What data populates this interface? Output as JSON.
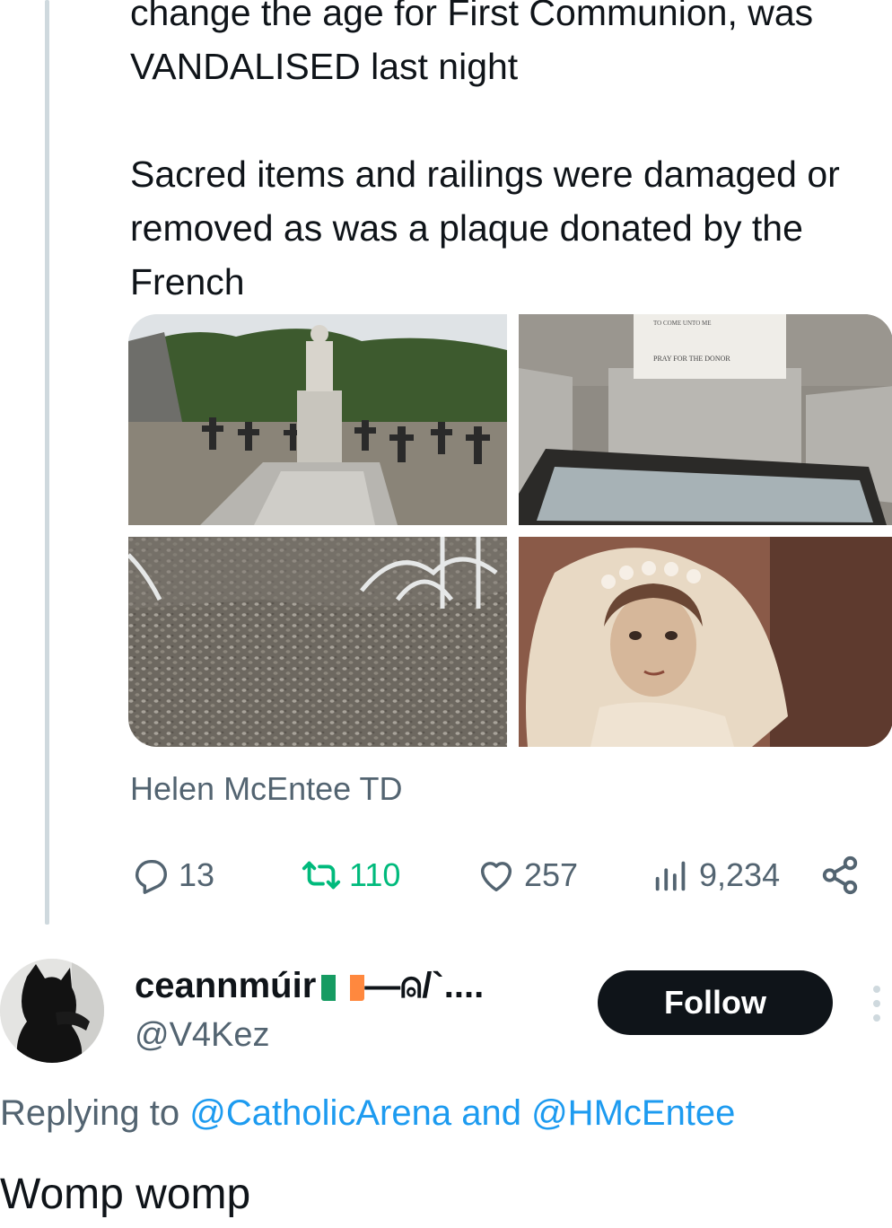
{
  "tweet": {
    "text_line1": "change the age for First Communion, was",
    "text_line2": "VANDALISED last night",
    "text_para2": "Sacred items and railings were damaged or removed as was a plaque donated by the French",
    "source_label": "Helen McEntee TD",
    "stats": {
      "replies": "13",
      "retweets": "110",
      "likes": "257",
      "views": "9,234"
    },
    "plaque_text_1": "TO COME UNTO ME",
    "plaque_text_2": "PRAY FOR THE DONOR"
  },
  "reply": {
    "display_name": "ceannmúir",
    "name_suffix": "—⍝/`....",
    "handle": "@V4Kez",
    "follow_label": "Follow",
    "replying_prefix": "Replying to",
    "replying_mentions": "@CatholicArena and @HMcEntee",
    "body": "Womp womp",
    "flag_colors": [
      "#169b62",
      "#ffffff",
      "#ff883e"
    ]
  },
  "colors": {
    "text": "#0f1419",
    "secondary": "#536471",
    "retweet": "#00ba7c",
    "link": "#1d9bf0"
  }
}
